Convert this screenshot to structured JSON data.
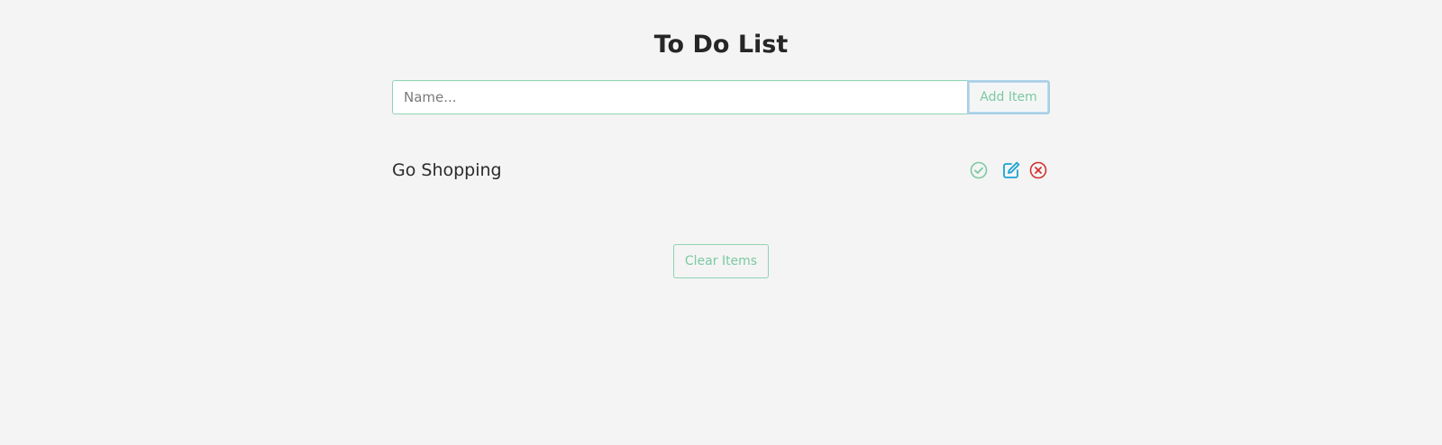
{
  "page": {
    "title": "To Do List"
  },
  "form": {
    "name_placeholder": "Name...",
    "name_value": "",
    "add_label": "Add Item"
  },
  "items": [
    {
      "label": "Go Shopping",
      "actions": {
        "complete_icon": "check-circle-icon",
        "edit_icon": "edit-icon",
        "delete_icon": "times-circle-icon"
      }
    }
  ],
  "footer": {
    "clear_label": "Clear Items"
  },
  "colors": {
    "accent_green": "#7cc9a3",
    "edit_blue": "#1aa3d1",
    "delete_red": "#d32f2f",
    "background": "#f4f4f4"
  }
}
